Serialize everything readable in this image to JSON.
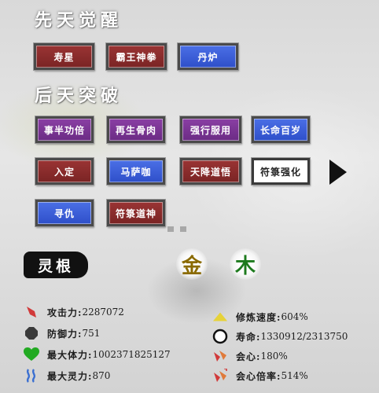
{
  "innate": {
    "title": "先天觉醒",
    "buttons": [
      {
        "label": "寿星",
        "color": "red"
      },
      {
        "label": "霸王神拳",
        "color": "red"
      },
      {
        "label": "丹炉",
        "color": "blue"
      }
    ]
  },
  "acquired": {
    "title": "后天突破",
    "rows": [
      [
        {
          "label": "事半功倍",
          "color": "purple"
        },
        {
          "label": "再生骨肉",
          "color": "purple"
        },
        {
          "label": "强行服用",
          "color": "purple"
        },
        {
          "label": "长命百岁",
          "color": "blue"
        }
      ],
      [
        {
          "label": "入定",
          "color": "red"
        },
        {
          "label": "马萨咖",
          "color": "blue"
        },
        {
          "label": "天降道悟",
          "color": "red"
        },
        {
          "label": "符箓强化",
          "color": "white"
        }
      ],
      [
        {
          "label": "寻仇",
          "color": "blue"
        },
        {
          "label": "符箓道神",
          "color": "red"
        }
      ]
    ]
  },
  "root": {
    "label": "灵根",
    "elements": [
      {
        "char": "金",
        "color": "#8a6a00"
      },
      {
        "char": "木",
        "color": "#1d7a1d"
      }
    ]
  },
  "stats": {
    "left": [
      {
        "label": "攻击力:",
        "value": "2287072",
        "icon": "sword-icon",
        "color": "#d13a3a"
      },
      {
        "label": "防御力:",
        "value": "751",
        "icon": "shield-icon",
        "color": "#3a3a3a"
      },
      {
        "label": "最大体力:",
        "value": "1002371825127",
        "icon": "heart-icon",
        "color": "#22aa22"
      },
      {
        "label": "最大灵力:",
        "value": "870",
        "icon": "spirit-wave-icon",
        "color": "#3a6fd1"
      }
    ],
    "right": [
      {
        "label": "修炼速度:",
        "value": "604%",
        "icon": "speed-triangle-icon",
        "color": "#e6d23a"
      },
      {
        "label": "寿命:",
        "value": "1330912/2313750",
        "icon": "lifespan-circle-icon",
        "color": "#111111"
      },
      {
        "label": "会心:",
        "value": "180%",
        "icon": "crit-icon",
        "color": "#d13a3a"
      },
      {
        "label": "会心倍率:",
        "value": "514%",
        "icon": "crit-multiplier-icon",
        "color": "#d13a3a"
      }
    ]
  }
}
